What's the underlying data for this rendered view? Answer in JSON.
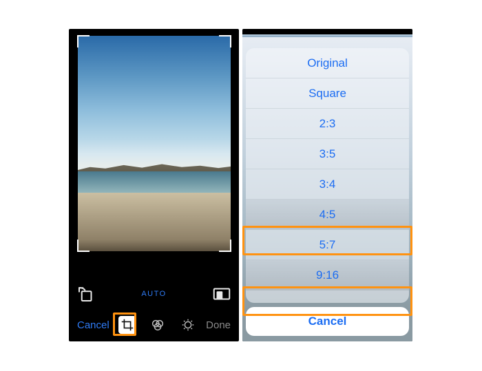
{
  "left": {
    "auto_label": "AUTO",
    "cancel": "Cancel",
    "done": "Done",
    "tools": {
      "rotate": "rotate-icon",
      "aspect": "aspect-icon",
      "crop": "crop-icon",
      "filters": "filters-icon",
      "adjust": "adjust-icon"
    }
  },
  "right": {
    "ratios": [
      "Original",
      "Square",
      "2:3",
      "3:5",
      "3:4",
      "4:5",
      "5:7",
      "9:16"
    ],
    "highlighted_indexes": [
      5,
      7
    ],
    "cancel": "Cancel"
  },
  "colors": {
    "accent": "#1c6df2",
    "highlight": "#ff9210"
  }
}
